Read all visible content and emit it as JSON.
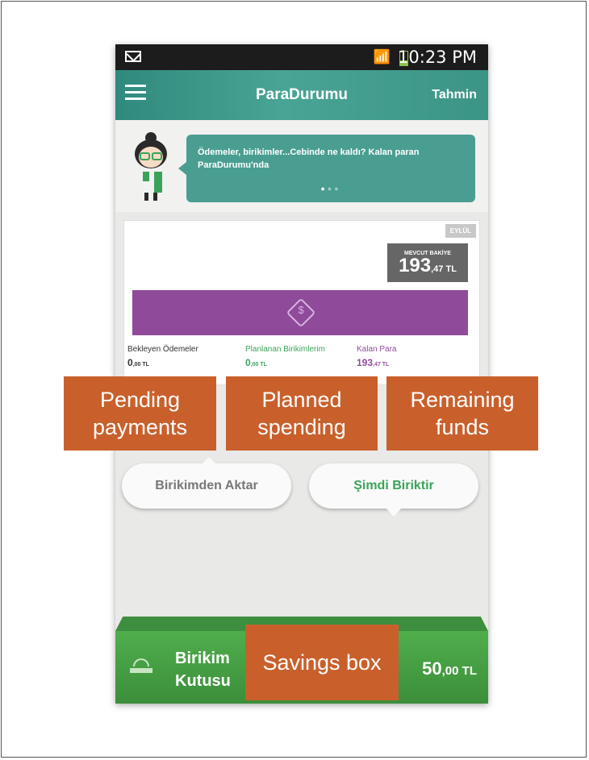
{
  "status_bar": {
    "time": "10:23 PM"
  },
  "app_bar": {
    "title": "ParaDurumu",
    "action": "Tahmin"
  },
  "banner": {
    "message": "Ödemeler, birikimler...Cebinde ne kaldı? Kalan paran ParaDurumu'nda",
    "page_count": 3,
    "active_page": 1
  },
  "summary": {
    "month": "EYLÜL",
    "balance_label": "MEVCUT BAKİYE",
    "balance_int": "193",
    "balance_dec": ",47 TL",
    "items": [
      {
        "label": "Bekleyen Ödemeler",
        "int": "0",
        "dec": ",00 TL",
        "color": "#333333"
      },
      {
        "label": "Planlanan Birikimlerim",
        "int": "0",
        "dec": ",00 TL",
        "color": "#3aa35a"
      },
      {
        "label": "Kalan Para",
        "int": "193",
        "dec": ",47 TL",
        "color": "#8f4a9a"
      }
    ]
  },
  "buttons": {
    "transfer": "Birikimden Aktar",
    "save_now": "Şimdi Biriktir"
  },
  "savings_box": {
    "label_line1": "Birikim",
    "label_line2": "Kutusu",
    "amount_int": "50",
    "amount_dec": ",00 TL"
  },
  "callouts": {
    "pending": "Pending payments",
    "planned": "Planned spending",
    "remaining": "Remaining funds",
    "savings": "Savings box"
  },
  "colors": {
    "teal": "#3b9486",
    "purple": "#8f4a9a",
    "green": "#4fae4c",
    "callout": "#c9602c"
  }
}
